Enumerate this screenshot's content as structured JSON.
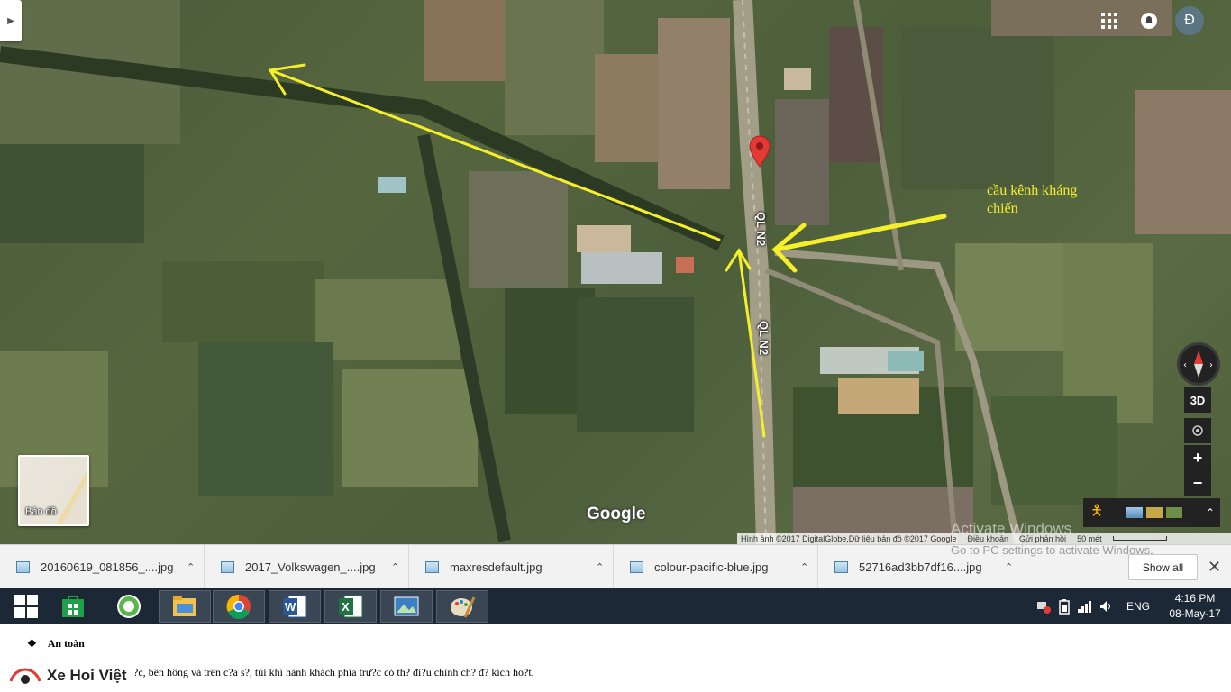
{
  "map": {
    "road_labels": [
      "QL N2",
      "QL N2"
    ],
    "annotation_line1": "cầu kênh kháng",
    "annotation_line2": "chiến",
    "layer_toggle_label": "Bản đồ",
    "google_logo": "Google",
    "profile_initial": "Đ",
    "controls": {
      "view_3d": "3D",
      "zoom_in": "+",
      "zoom_out": "−"
    },
    "attribution": {
      "imagery": "Hình ảnh ©2017 DigitalGlobe,Dữ liệu bản đồ ©2017 Google",
      "terms": "Điều khoản",
      "feedback": "Gửi phản hồi",
      "scale": "50 mét"
    },
    "watermark_line1": "Activate Windows",
    "watermark_line2": "Go to PC settings to activate Windows.",
    "colors": {
      "arrow": "#f4ef2a",
      "pin": "#e53935",
      "road": "#9a9680"
    }
  },
  "downloads": {
    "files": [
      "20160619_081856_....jpg",
      "2017_Volkswagen_....jpg",
      "maxresdefault.jpg",
      "colour-pacific-blue.jpg",
      "52716ad3bb7df16....jpg"
    ],
    "show_all": "Show all",
    "close": "✕"
  },
  "taskbar": {
    "apps": [
      "windows-start",
      "store",
      "coccoc",
      "file-explorer",
      "chrome",
      "word",
      "excel",
      "photos",
      "paint"
    ],
    "language": "ENG",
    "time": "4:16 PM",
    "date": "08-May-17"
  },
  "doc": {
    "heading": "An toàn",
    "line1": "?c, bên hông và trên c?a s?, túi khí hành khách phía trư?c có th? đi?u chỉnh ch? đ? kích ho?t.",
    "brand": "Xe Hoi Việt"
  }
}
